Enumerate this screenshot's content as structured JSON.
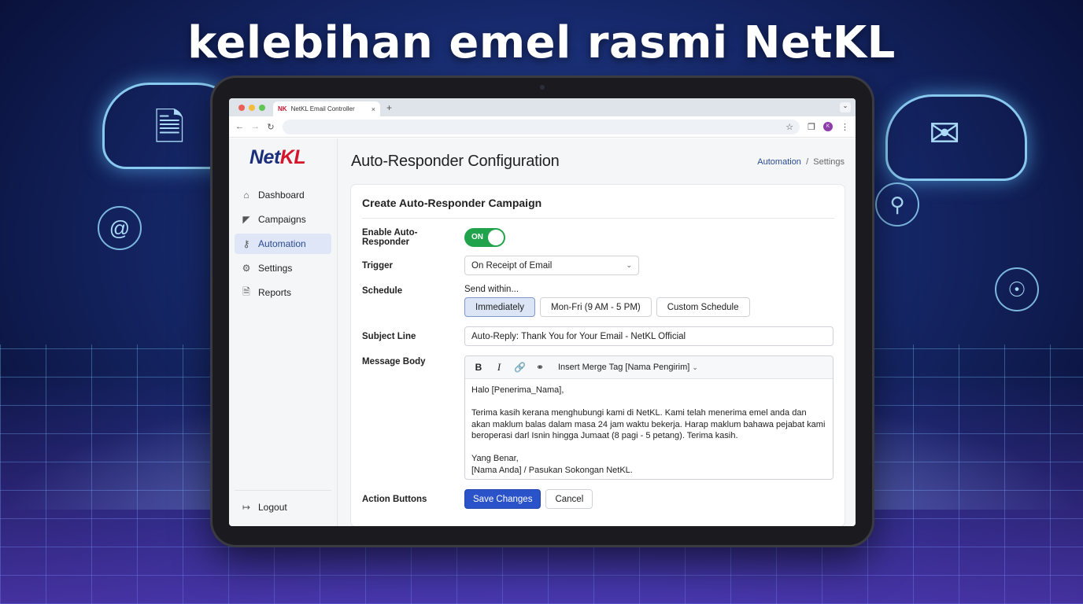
{
  "headline": "kelebihan emel rasmi NetKL",
  "browser": {
    "tab_logo": "NK",
    "tab_title": "NetKL Email Controller",
    "tab_close": "×",
    "new_tab": "+",
    "profile_initials": "K"
  },
  "sidebar": {
    "logo_primary": "Net",
    "logo_accent": "KL",
    "items": [
      {
        "label": "Dashboard",
        "icon": "home-icon"
      },
      {
        "label": "Campaigns",
        "icon": "megaphone-icon"
      },
      {
        "label": "Automation",
        "icon": "network-icon",
        "active": true
      },
      {
        "label": "Settings",
        "icon": "gear-icon"
      },
      {
        "label": "Reports",
        "icon": "document-icon"
      }
    ],
    "logout_label": "Logout"
  },
  "page": {
    "title": "Auto-Responder Configuration",
    "breadcrumb": {
      "parent": "Automation",
      "separator": "/",
      "current": "Settings"
    }
  },
  "form": {
    "card_title": "Create Auto-Responder Campaign",
    "enable": {
      "label": "Enable Auto-Responder",
      "toggle_text": "ON",
      "value": true
    },
    "trigger": {
      "label": "Trigger",
      "value": "On Receipt of Email"
    },
    "schedule": {
      "label": "Schedule",
      "hint": "Send within...",
      "options": [
        "Immediately",
        "Mon-Fri (9 AM - 5 PM)",
        "Custom Schedule"
      ],
      "selected": "Immediately"
    },
    "subject": {
      "label": "Subject Line",
      "value": "Auto-Reply: Thank You for Your Email - NetKL Official"
    },
    "message": {
      "label": "Message Body",
      "toolbar": {
        "bold": "B",
        "italic": "I",
        "merge_tag": "Insert Merge Tag [Nama Pengirim]"
      },
      "greeting": "Halo [Penerima_Nama],",
      "paragraph_1": "Terima kasih kerana menghubungi kami di NetKL. Kami telah menerima emel anda dan akan maklum balas dalam masa 24 jam waktu bekerja. Harap maklum bahawa pejabat kami beroperasi darl Isnin hingga Jumaat (8 pagi - 5 petang). Terima kasih.",
      "closing": "Yang Benar,",
      "signature": "[Nama Anda] / Pasukan Sokongan NetKL."
    },
    "actions": {
      "label": "Action Buttons",
      "save": "Save Changes",
      "cancel": "Cancel"
    }
  },
  "colors": {
    "brand_navy": "#1c2f7a",
    "brand_red": "#d4162c",
    "primary_button": "#2a52c9",
    "toggle_on": "#20a34a",
    "active_nav": "#dfe6f7"
  }
}
